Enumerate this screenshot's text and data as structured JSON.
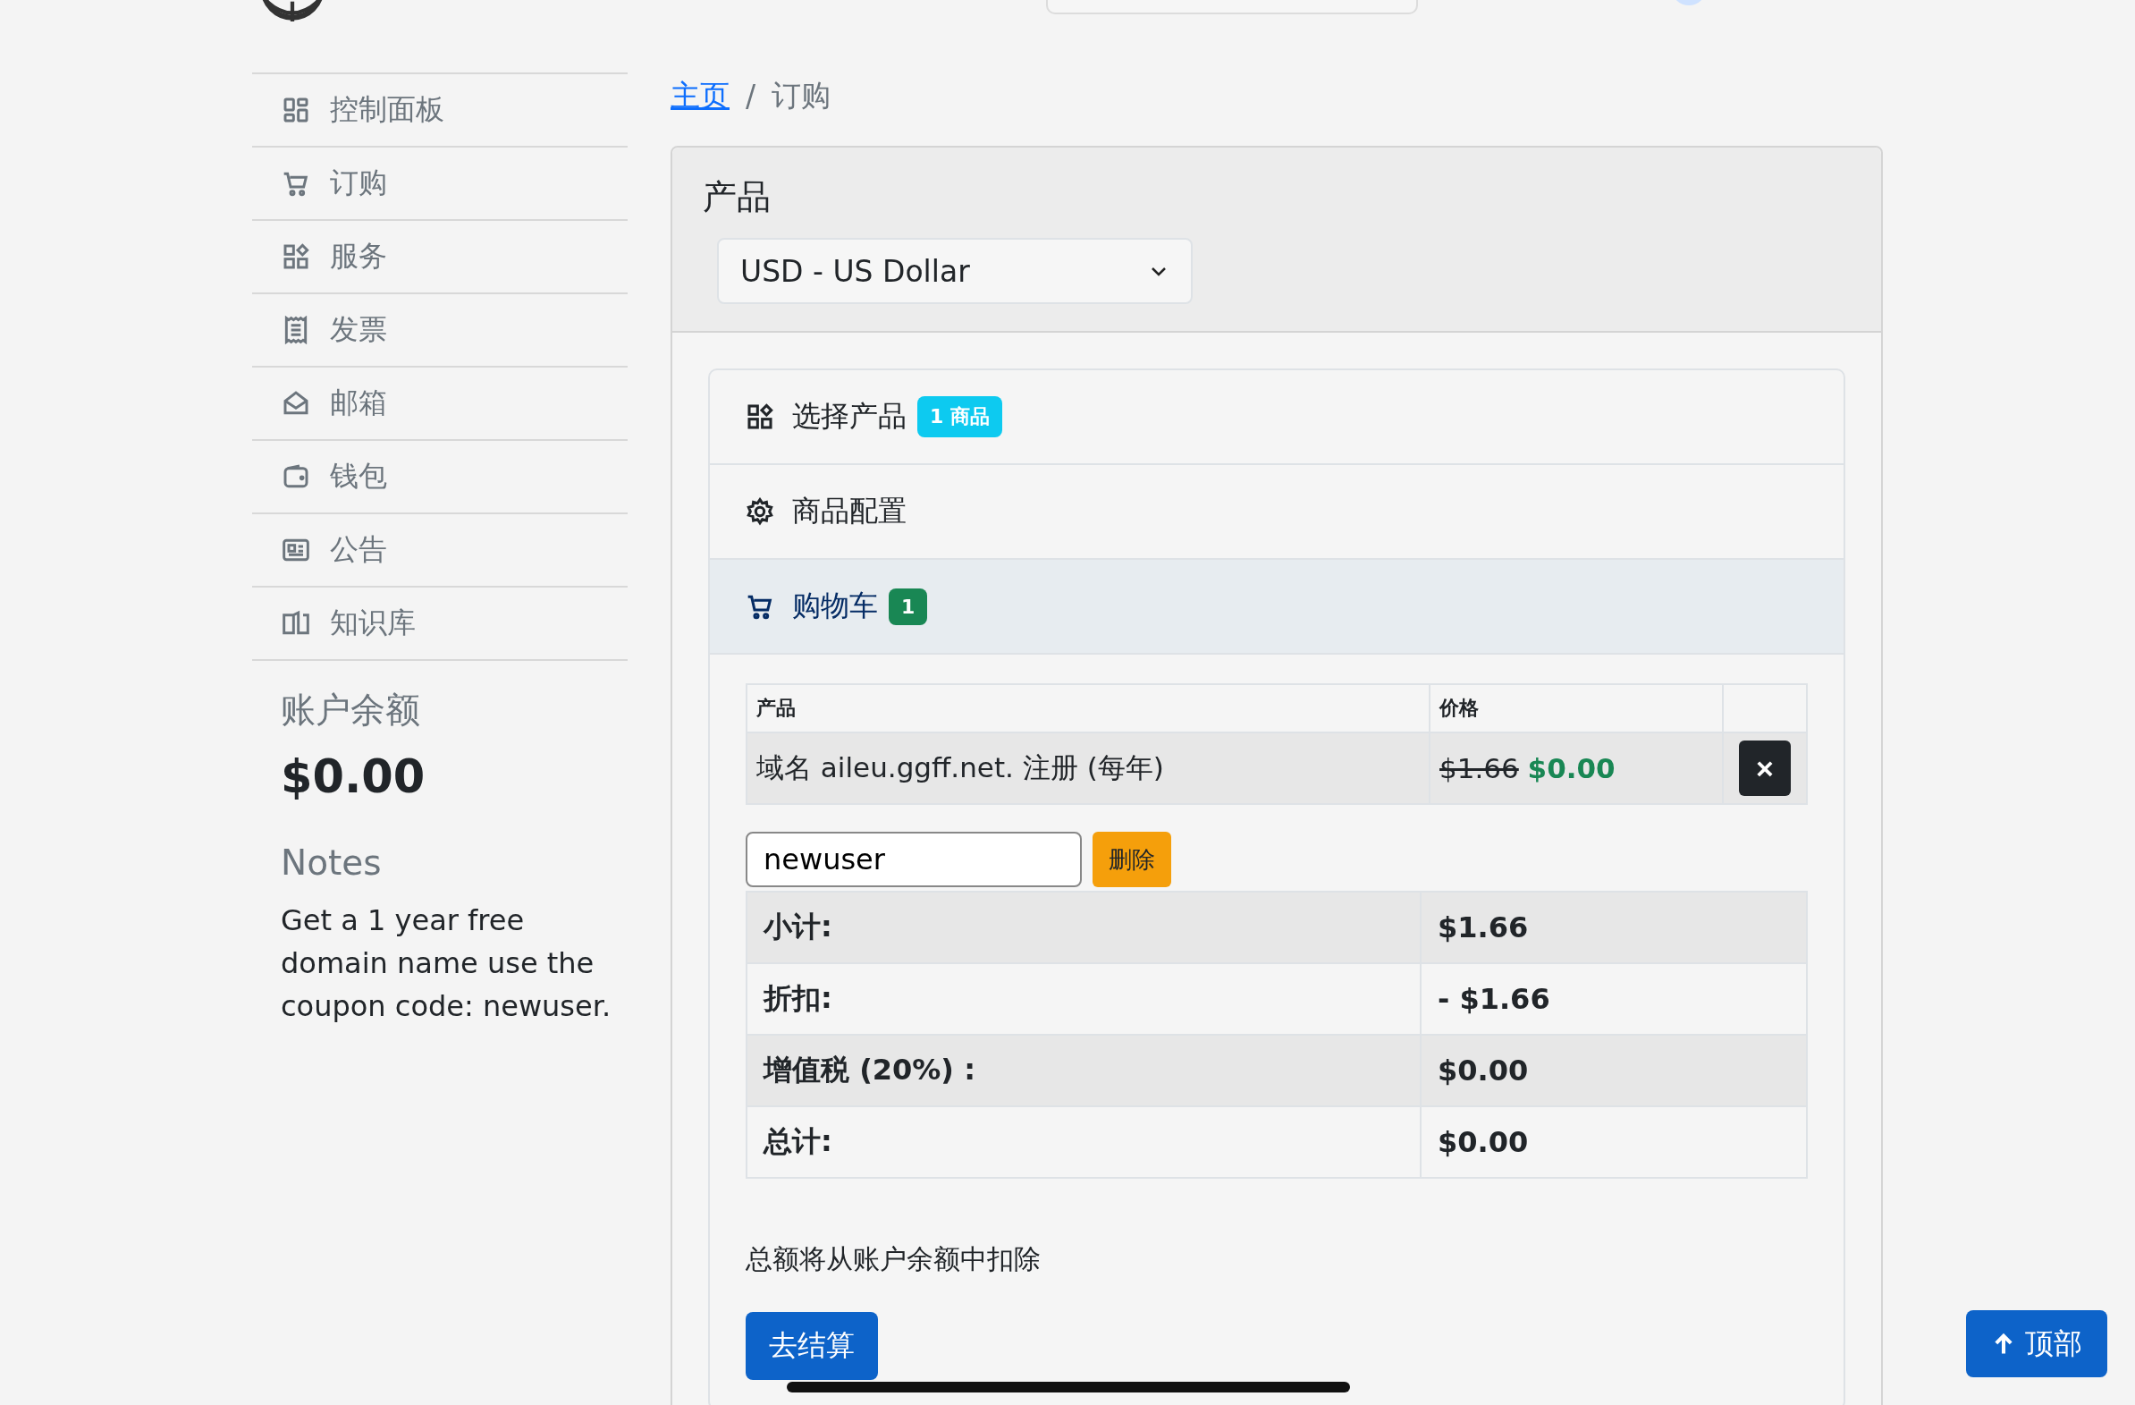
{
  "sidebar": {
    "items": [
      {
        "label": "控制面板"
      },
      {
        "label": "订购"
      },
      {
        "label": "服务"
      },
      {
        "label": "发票"
      },
      {
        "label": "邮箱"
      },
      {
        "label": "钱包"
      },
      {
        "label": "公告"
      },
      {
        "label": "知识库"
      }
    ],
    "balance": {
      "title": "账户余额",
      "amount": "$0.00"
    },
    "notes": {
      "title": "Notes",
      "text": "Get a 1 year free domain name use the coupon code: newuser."
    }
  },
  "breadcrumb_separator": "/",
  "breadcrumb": [
    {
      "label": "主页",
      "link": true
    },
    {
      "label": "订购",
      "link": false
    }
  ],
  "card": {
    "title": "产品",
    "currency": "USD - US Dollar"
  },
  "steps": [
    {
      "label": "选择产品",
      "selected": false,
      "badge": {
        "text": "1 商品",
        "color": "#0dcaf0"
      }
    },
    {
      "label": "商品配置",
      "selected": false
    },
    {
      "label": "购物车",
      "selected": true,
      "badge": {
        "text": "1",
        "color": "#198754"
      }
    }
  ],
  "cart": {
    "columns": [
      "产品",
      "价格"
    ],
    "rows": [
      {
        "product": "域名 aileu.ggff.net. 注册 (每年)",
        "old_price": "$1.66",
        "price": "$0.00",
        "remove": "×"
      }
    ],
    "coupon": {
      "value": "newuser",
      "button": "删除"
    },
    "totals": [
      {
        "label": "小计:",
        "value": "$1.66"
      },
      {
        "label": "折扣:",
        "value": "- $1.66"
      },
      {
        "label": "增值税 (20%) :",
        "value": "$0.00"
      },
      {
        "label": "总计:",
        "value": "$0.00"
      }
    ],
    "note": "总额将从账户余额中扣除",
    "checkout": "去结算"
  },
  "back_to_top": "顶部"
}
